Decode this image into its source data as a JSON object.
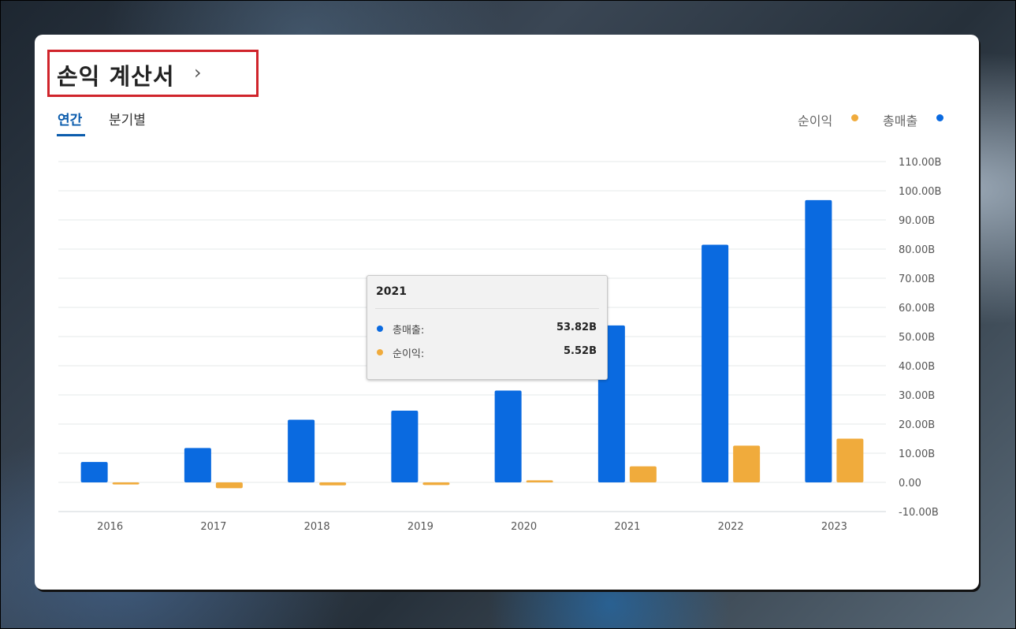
{
  "header": {
    "title": "손익 계산서",
    "chevron": "›"
  },
  "tabs": [
    {
      "label": "연간",
      "active": true
    },
    {
      "label": "분기별",
      "active": false
    }
  ],
  "legend": [
    {
      "label": "순이익",
      "color": "#f0ab3c"
    },
    {
      "label": "총매출",
      "color": "#0a6ae0"
    }
  ],
  "tooltip": {
    "year": "2021",
    "rows": [
      {
        "label": "총매출:",
        "value": "53.82B",
        "color": "#0a6ae0"
      },
      {
        "label": "순이익:",
        "value": "5.52B",
        "color": "#f0ab3c"
      }
    ]
  },
  "chart_data": {
    "type": "bar",
    "categories": [
      "2016",
      "2017",
      "2018",
      "2019",
      "2020",
      "2021",
      "2022",
      "2023"
    ],
    "series": [
      {
        "name": "총매출",
        "color": "#0a6ae0",
        "values": [
          7.0,
          11.8,
          21.5,
          24.6,
          31.5,
          53.82,
          81.5,
          96.8
        ]
      },
      {
        "name": "순이익",
        "color": "#f0ab3c",
        "values": [
          -0.7,
          -2.0,
          -1.0,
          -0.9,
          0.7,
          5.52,
          12.6,
          15.0
        ]
      }
    ],
    "ylim": [
      -10,
      110
    ],
    "yticks": [
      110,
      100,
      90,
      80,
      70,
      60,
      50,
      40,
      30,
      20,
      10,
      0,
      -10
    ],
    "ytick_labels": [
      "110.00B",
      "100.00B",
      "90.00B",
      "80.00B",
      "70.00B",
      "60.00B",
      "50.00B",
      "40.00B",
      "30.00B",
      "20.00B",
      "10.00B",
      "0.00",
      "-10.00B"
    ],
    "grid": true
  }
}
